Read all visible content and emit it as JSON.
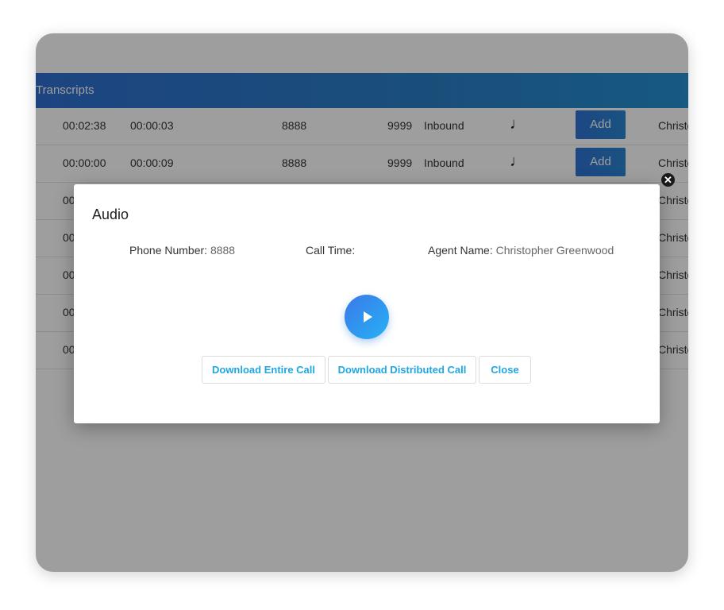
{
  "header": {
    "title": "Transcripts"
  },
  "rows": [
    {
      "duration": "00:02:38",
      "wait": "00:00:03",
      "from": "8888",
      "to": "9999",
      "direction": "Inbound",
      "add_label": "Add",
      "agent": "Christo"
    },
    {
      "duration": "00:00:00",
      "wait": "00:00:09",
      "from": "8888",
      "to": "9999",
      "direction": "Inbound",
      "add_label": "Add",
      "agent": "Christo"
    },
    {
      "duration": "00",
      "agent": "Christo"
    },
    {
      "duration": "00",
      "agent": "Christo"
    },
    {
      "duration": "00",
      "agent": "Christo"
    },
    {
      "duration": "00",
      "agent": "Christo"
    },
    {
      "duration": "00",
      "agent": "Christo"
    }
  ],
  "modal": {
    "title": "Audio",
    "phone_label": "Phone Number:",
    "phone_value": "8888",
    "call_time_label": "Call Time:",
    "call_time_value": "",
    "agent_label": "Agent Name:",
    "agent_value": "Christopher Greenwood",
    "download_entire": "Download Entire Call",
    "download_distributed": "Download Distributed Call",
    "close": "Close"
  },
  "icons": {
    "audio": "music-note-icon",
    "play": "play-icon",
    "dismiss": "close-circle-icon"
  },
  "colors": {
    "accent": "#2f6fd0",
    "button_text": "#1fa7e0"
  }
}
